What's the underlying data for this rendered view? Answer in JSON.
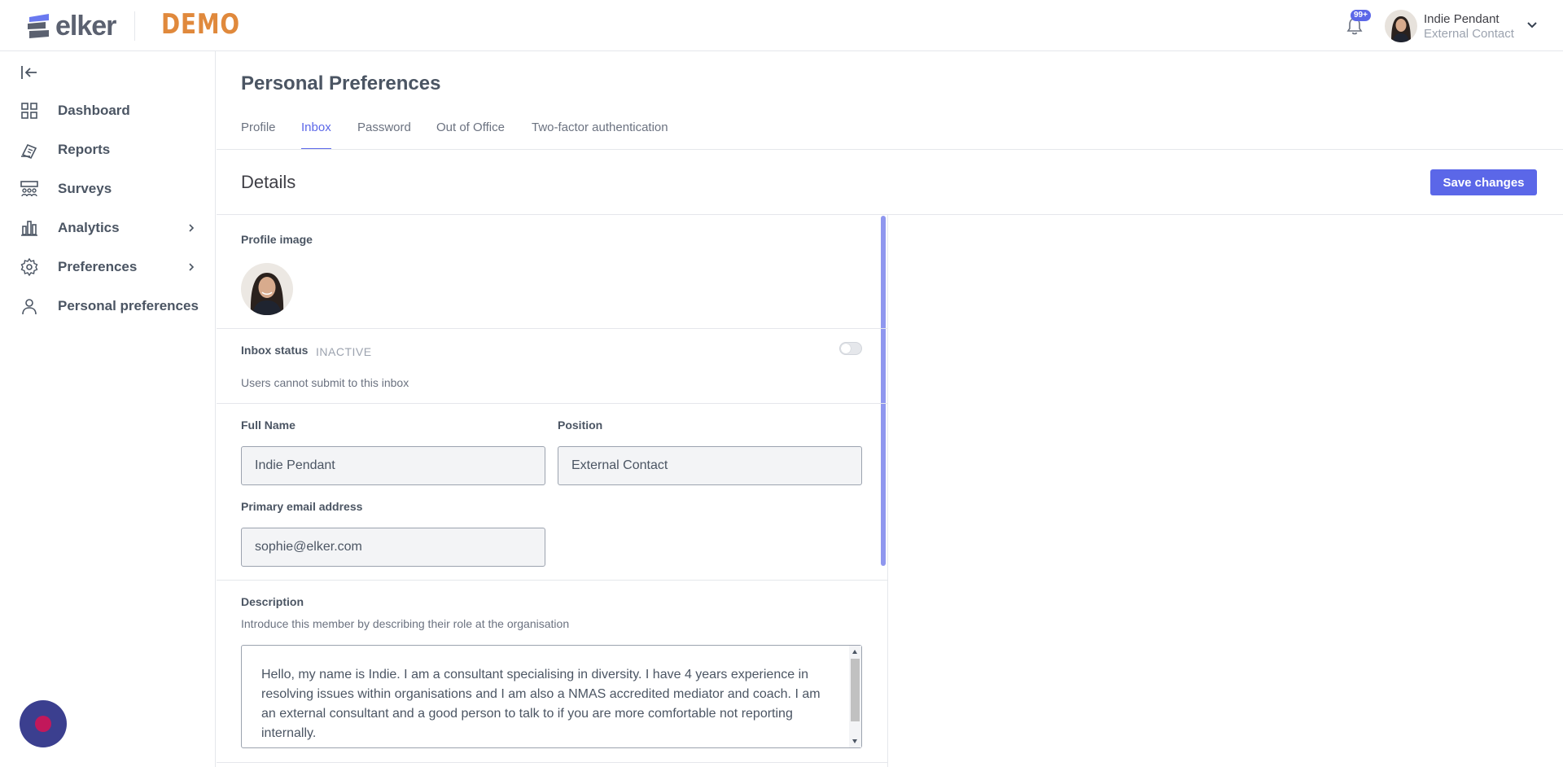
{
  "header": {
    "logo_text": "elker",
    "demo_label": "DEMO",
    "notifications_badge": "99+",
    "user_name": "Indie Pendant",
    "user_role": "External Contact"
  },
  "sidebar": {
    "items": [
      {
        "label": "Dashboard",
        "icon": "dashboard-icon"
      },
      {
        "label": "Reports",
        "icon": "reports-icon"
      },
      {
        "label": "Surveys",
        "icon": "surveys-icon"
      },
      {
        "label": "Analytics",
        "icon": "analytics-icon"
      },
      {
        "label": "Preferences",
        "icon": "gear-icon"
      },
      {
        "label": "Personal preferences",
        "icon": "user-icon"
      }
    ]
  },
  "main": {
    "title": "Personal Preferences",
    "tabs": [
      {
        "label": "Profile"
      },
      {
        "label": "Inbox",
        "active": true
      },
      {
        "label": "Password"
      },
      {
        "label": "Out of Office"
      },
      {
        "label": "Two-factor authentication"
      }
    ],
    "section_title": "Details",
    "save_label": "Save changes"
  },
  "form": {
    "profile_image_label": "Profile image",
    "inbox_status_label": "Inbox status",
    "inbox_status_value": "INACTIVE",
    "inbox_status_description": "Users cannot submit to this inbox",
    "full_name_label": "Full Name",
    "full_name_value": "Indie Pendant",
    "position_label": "Position",
    "position_value": "External Contact",
    "email_label": "Primary email address",
    "email_value": "sophie@elker.com",
    "description_label": "Description",
    "description_help": "Introduce this member by describing their role at the organisation",
    "description_value": "Hello, my name is Indie. I am a consultant specialising in diversity. I have 4 years experience in resolving issues within organisations and I am also a NMAS accredited mediator and coach. I am an external consultant and a good person to talk to if you are more comfortable not reporting internally."
  },
  "colors": {
    "accent": "#5b67e8",
    "demo": "#e0893c",
    "logo": "#5b6170",
    "chat": "#3b3f8f"
  }
}
